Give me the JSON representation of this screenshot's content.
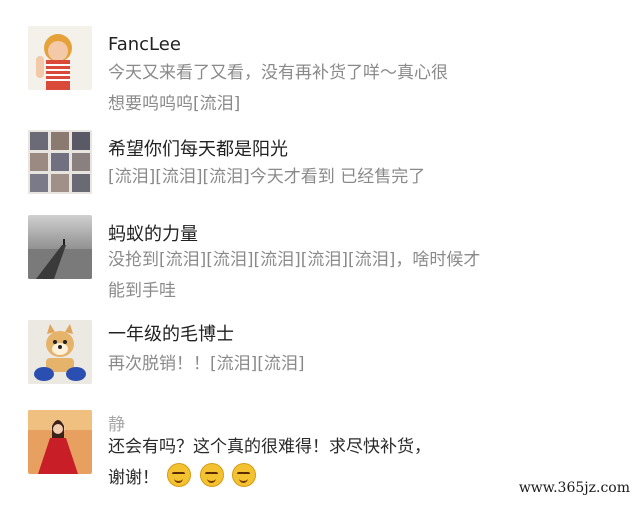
{
  "comments": [
    {
      "name": "FancLee",
      "avatar": "girl-photo",
      "lines": [
        "今天又来看了又看，没有再补货了咩～真心很",
        "想要呜呜呜[流泪]"
      ]
    },
    {
      "name": "希望你们每天都是阳光",
      "avatar": "photo-collage",
      "lines": [
        "[流泪][流泪][流泪]今天才看到 已经售完了"
      ]
    },
    {
      "name": "蚂蚁的力量",
      "avatar": "pier-photo",
      "lines": [
        "没抢到[流泪][流泪][流泪][流泪][流泪]，啥时候才",
        "能到手哇"
      ]
    },
    {
      "name": "一年级的毛博士",
      "avatar": "dog-photo",
      "lines": [
        "再次脱销！！[流泪][流泪]"
      ]
    },
    {
      "name": "静",
      "avatar": "woman-red-dress-photo",
      "lines": [
        "还会有吗？这个真的很难得！求尽快补货，",
        "谢谢！"
      ],
      "emoji_count": 3,
      "emoji": "grimace-face"
    }
  ],
  "watermark": "www.365jz.com"
}
